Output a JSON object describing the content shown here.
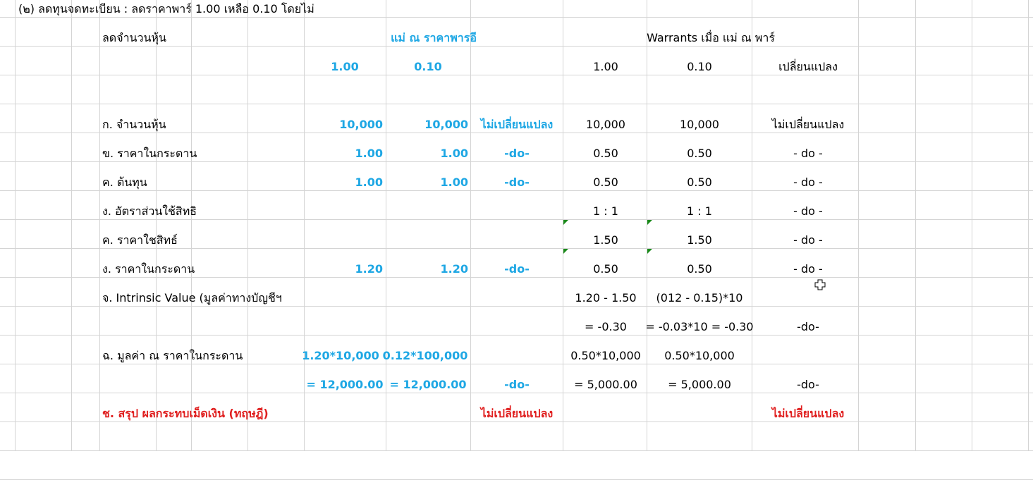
{
  "rows": [
    {
      "num": "36",
      "cells": {
        "a": "(๒) ลดทุนจดทะเบียน :  ลดราคาพาร์ 1.00 เหลือ 0.10 โดยไม่"
      }
    },
    {
      "num": "37",
      "cells": {
        "b": "ลดจำนวนหุ้น",
        "hdr1": "แม่ ณ ราคาพารอี",
        "hdr2": "Warrants เมื่อ แม่ ณ พาร์"
      }
    },
    {
      "num": "38",
      "cells": {
        "c1": "1.00",
        "c2": "0.10",
        "w1": "1.00",
        "w2": "0.10",
        "w3": "เปลี่ยนแปลง"
      }
    },
    {
      "num": "39",
      "cells": {}
    },
    {
      "num": "40",
      "cells": {
        "b": "ก. จำนวนหุ้น",
        "c1": "10,000",
        "c2": "10,000",
        "c3": "ไม่เปลี่ยนแปลง",
        "w1": "10,000",
        "w2": "10,000",
        "w3": "ไม่เปลี่ยนแปลง"
      }
    },
    {
      "num": "41",
      "cells": {
        "b": "ข. ราคาในกระดาน",
        "c1": "1.00",
        "c2": "1.00",
        "c3": "-do-",
        "w1": "0.50",
        "w2": "0.50",
        "w3": "- do -"
      }
    },
    {
      "num": "42",
      "cells": {
        "b": "ค. ต้นทุน",
        "c1": "1.00",
        "c2": "1.00",
        "c3": "-do-",
        "w1": "0.50",
        "w2": "0.50",
        "w3": "- do -"
      }
    },
    {
      "num": "43",
      "cells": {
        "b": "ง. อัตราส่วนใช้สิทธิ",
        "w1": "1 : 1",
        "w2": "1 : 1",
        "w3": "- do -"
      }
    },
    {
      "num": "44",
      "cells": {
        "b": "ค. ราคาใชสิทธ์",
        "w1": "1.50",
        "w2": "1.50",
        "w3": "- do -"
      }
    },
    {
      "num": "45",
      "cells": {
        "b": "ง. ราคาในกระดาน",
        "c1": "1.20",
        "c2": "1.20",
        "c3": "-do-",
        "w1": "0.50",
        "w2": "0.50",
        "w3": "- do -"
      }
    },
    {
      "num": "46",
      "cells": {
        "b": "จ.  Intrinsic Value (มูลค่าทางบัญชีฯ",
        "w1": "1.20 - 1.50",
        "w2": "(012 - 0.15)*10"
      }
    },
    {
      "num": "47",
      "cells": {
        "w1": "= -0.30",
        "w2": "= -0.03*10 = -0.30",
        "w3": "-do-"
      }
    },
    {
      "num": "48",
      "cells": {
        "b": "ฉ. มูลค่า ณ ราคาในกระดาน",
        "c1": "1.20*10,000",
        "c2": "0.12*100,000",
        "w1": "0.50*10,000",
        "w2": "0.50*10,000"
      }
    },
    {
      "num": "49",
      "cells": {
        "c1": "= 12,000.00",
        "c2": "= 12,000.00",
        "c3": "-do-",
        "w1": "= 5,000.00",
        "w2": "= 5,000.00",
        "w3": "-do-"
      }
    },
    {
      "num": "50",
      "cells": {
        "b": "ช. สรุป ผลกระทบเม็ดเงิน (ทฤษฎี)",
        "c3": "ไม่เปลี่ยนแปลง",
        "w3": "ไม่เปลี่ยนแปลง"
      }
    },
    {
      "num": "51",
      "cells": {}
    }
  ],
  "colors": {
    "blue": "#1ea7e4",
    "red": "#e02020",
    "comment_marker": "#1b8a1b"
  },
  "cursor": "cross-cursor-icon"
}
